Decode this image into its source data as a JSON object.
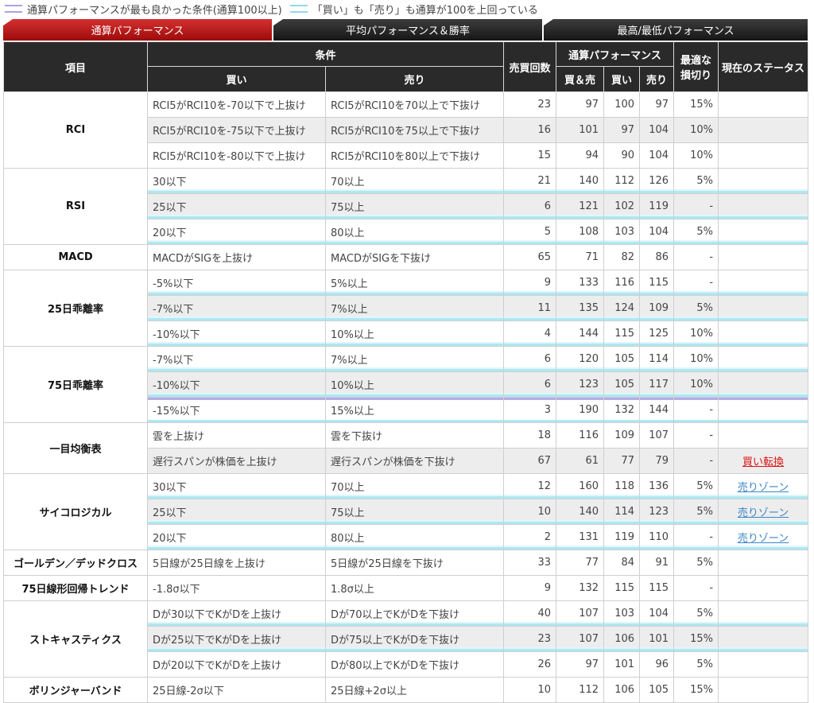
{
  "legend": {
    "purple_label": "通算パフォーマンスが最も良かった条件(通算100以上)",
    "cyan_label": "「買い」も「売り」も通算が100を上回っている"
  },
  "tabs": [
    "通算パフォーマンス",
    "平均パフォーマンス＆勝率",
    "最高/最低パフォーマンス"
  ],
  "header": {
    "item": "項目",
    "condition": "条件",
    "buy": "買い",
    "sell": "売り",
    "trades": "売買回数",
    "performance": "通算パフォーマンス",
    "both": "買＆売",
    "perf_buy": "買い",
    "perf_sell": "売り",
    "stoploss": "最適な損切り",
    "status": "現在のステータス"
  },
  "groups": [
    {
      "name": "RCI",
      "rows": [
        {
          "buy": "RCI5がRCI10を-70以下で上抜け",
          "sell": "RCI5がRCI10を70以上で下抜け",
          "trades": "23",
          "both": "97",
          "b": "100",
          "s": "97",
          "sl": "15%",
          "status": ""
        },
        {
          "buy": "RCI5がRCI10を-75以下で上抜け",
          "sell": "RCI5がRCI10を75以上で下抜け",
          "trades": "16",
          "both": "101",
          "b": "97",
          "s": "104",
          "sl": "10%",
          "status": ""
        },
        {
          "buy": "RCI5がRCI10を-80以下で上抜け",
          "sell": "RCI5がRCI10を80以上で下抜け",
          "trades": "15",
          "both": "94",
          "b": "90",
          "s": "104",
          "sl": "10%",
          "status": ""
        }
      ]
    },
    {
      "name": "RSI",
      "rows": [
        {
          "buy": "30以下",
          "sell": "70以上",
          "trades": "21",
          "both": "140",
          "b": "112",
          "s": "126",
          "sl": "5%",
          "status": ""
        },
        {
          "buy": "25以下",
          "sell": "75以上",
          "trades": "6",
          "both": "121",
          "b": "102",
          "s": "119",
          "sl": "-",
          "status": ""
        },
        {
          "buy": "20以下",
          "sell": "80以上",
          "trades": "5",
          "both": "108",
          "b": "103",
          "s": "104",
          "sl": "5%",
          "status": ""
        }
      ]
    },
    {
      "name": "MACD",
      "rows": [
        {
          "buy": "MACDがSIGを上抜け",
          "sell": "MACDがSIGを下抜け",
          "trades": "65",
          "both": "71",
          "b": "82",
          "s": "86",
          "sl": "-",
          "status": ""
        }
      ]
    },
    {
      "name": "25日乖離率",
      "rows": [
        {
          "buy": "-5%以下",
          "sell": "5%以上",
          "trades": "9",
          "both": "133",
          "b": "116",
          "s": "115",
          "sl": "-",
          "status": ""
        },
        {
          "buy": "-7%以下",
          "sell": "7%以上",
          "trades": "11",
          "both": "135",
          "b": "124",
          "s": "109",
          "sl": "5%",
          "status": ""
        },
        {
          "buy": "-10%以下",
          "sell": "10%以上",
          "trades": "4",
          "both": "144",
          "b": "115",
          "s": "125",
          "sl": "10%",
          "status": ""
        }
      ]
    },
    {
      "name": "75日乖離率",
      "rows": [
        {
          "buy": "-7%以下",
          "sell": "7%以上",
          "trades": "6",
          "both": "120",
          "b": "105",
          "s": "114",
          "sl": "10%",
          "status": ""
        },
        {
          "buy": "-10%以下",
          "sell": "10%以上",
          "trades": "6",
          "both": "123",
          "b": "105",
          "s": "117",
          "sl": "10%",
          "status": ""
        },
        {
          "buy": "-15%以下",
          "sell": "15%以上",
          "trades": "3",
          "both": "190",
          "b": "132",
          "s": "144",
          "sl": "-",
          "status": ""
        }
      ]
    },
    {
      "name": "一目均衡表",
      "rows": [
        {
          "buy": "雲を上抜け",
          "sell": "雲を下抜け",
          "trades": "18",
          "both": "116",
          "b": "109",
          "s": "107",
          "sl": "-",
          "status": ""
        },
        {
          "buy": "遅行スパンが株価を上抜け",
          "sell": "遅行スパンが株価を下抜け",
          "trades": "67",
          "both": "61",
          "b": "77",
          "s": "79",
          "sl": "-",
          "status": "買い転換"
        }
      ]
    },
    {
      "name": "サイコロジカル",
      "rows": [
        {
          "buy": "30以下",
          "sell": "70以上",
          "trades": "12",
          "both": "160",
          "b": "118",
          "s": "136",
          "sl": "5%",
          "status": "売りゾーン"
        },
        {
          "buy": "25以下",
          "sell": "75以上",
          "trades": "10",
          "both": "140",
          "b": "114",
          "s": "123",
          "sl": "5%",
          "status": "売りゾーン"
        },
        {
          "buy": "20以下",
          "sell": "80以上",
          "trades": "2",
          "both": "131",
          "b": "119",
          "s": "110",
          "sl": "-",
          "status": "売りゾーン"
        }
      ]
    },
    {
      "name": "ゴールデン／デッドクロス",
      "rows": [
        {
          "buy": "5日線が25日線を上抜け",
          "sell": "5日線が25日線を下抜け",
          "trades": "33",
          "both": "77",
          "b": "84",
          "s": "91",
          "sl": "5%",
          "status": ""
        }
      ]
    },
    {
      "name": "75日線形回帰トレンド",
      "rows": [
        {
          "buy": "-1.8σ以下",
          "sell": "1.8σ以上",
          "trades": "9",
          "both": "132",
          "b": "115",
          "s": "115",
          "sl": "-",
          "status": ""
        }
      ]
    },
    {
      "name": "ストキャスティクス",
      "rows": [
        {
          "buy": "Dが30以下でKがDを上抜け",
          "sell": "Dが70以上でKがDを下抜け",
          "trades": "40",
          "both": "107",
          "b": "103",
          "s": "104",
          "sl": "5%",
          "status": ""
        },
        {
          "buy": "Dが25以下でKがDを上抜け",
          "sell": "Dが75以上でKがDを下抜け",
          "trades": "23",
          "both": "107",
          "b": "106",
          "s": "101",
          "sl": "15%",
          "status": ""
        },
        {
          "buy": "Dが20以下でKがDを上抜け",
          "sell": "Dが80以上でKがDを下抜け",
          "trades": "26",
          "both": "97",
          "b": "101",
          "s": "96",
          "sl": "5%",
          "status": ""
        }
      ]
    },
    {
      "name": "ボリンジャーバンド",
      "rows": [
        {
          "buy": "25日線-2σ以下",
          "sell": "25日線+2σ以上",
          "trades": "10",
          "both": "112",
          "b": "106",
          "s": "105",
          "sl": "15%",
          "status": ""
        }
      ]
    }
  ],
  "colors": {
    "active_tab": "#b71414",
    "header_bg": "#2a2a2a",
    "highlight_purple": "#b3aee6",
    "highlight_cyan": "#aee8f2",
    "status_red": "#d11111",
    "status_blue": "#3a86c8"
  }
}
